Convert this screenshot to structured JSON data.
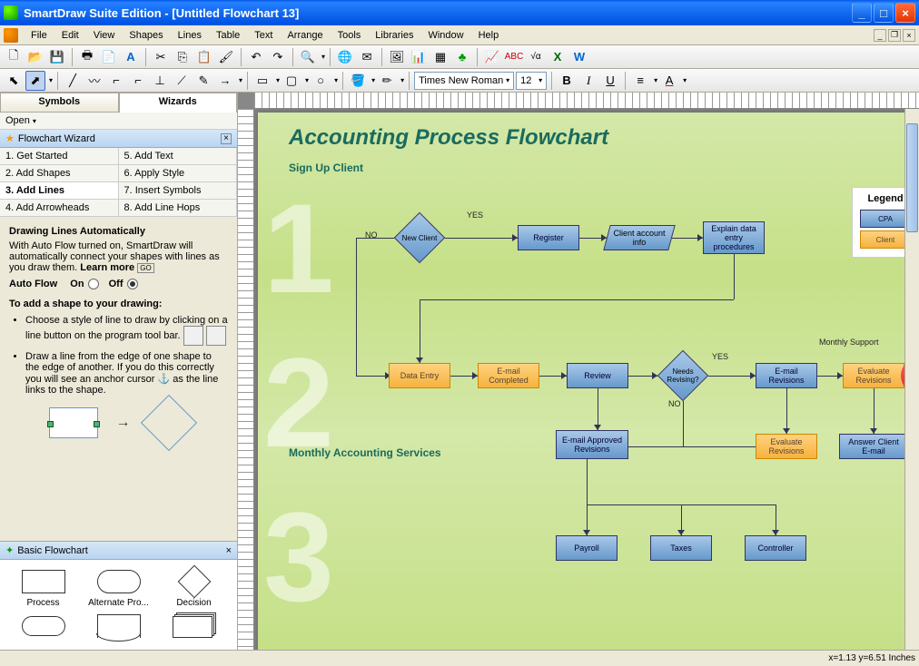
{
  "app": {
    "title": "SmartDraw Suite Edition - [Untitled Flowchart 13]"
  },
  "menu": [
    "File",
    "Edit",
    "View",
    "Shapes",
    "Lines",
    "Table",
    "Text",
    "Arrange",
    "Tools",
    "Libraries",
    "Window",
    "Help"
  ],
  "toolbar2": {
    "font": "Times New Roman",
    "size": "12",
    "bold": "B",
    "italic": "I",
    "underline": "U"
  },
  "sidebar": {
    "open_label": "Open",
    "tabs": {
      "symbols": "Symbols",
      "wizards": "Wizards"
    },
    "wizard_title": "Flowchart Wizard",
    "steps": [
      "1. Get Started",
      "5. Add Text",
      "2. Add Shapes",
      "6. Apply Style",
      "3. Add Lines",
      "7. Insert Symbols",
      "4. Add Arrowheads",
      "8. Add Line Hops"
    ],
    "active_step_index": 4,
    "help": {
      "heading": "Drawing Lines Automatically",
      "para1_a": "With Auto Flow turned on, SmartDraw will automatically connect your shapes with lines as you draw them. ",
      "learn_more": "Learn more",
      "autoflow_label": "Auto Flow",
      "on": "On",
      "off": "Off",
      "subhead": "To add a shape to your drawing:",
      "bullet1": "Choose a style of line to draw by clicking on a line button on the program tool bar.",
      "bullet2_a": "Draw a line from the edge of one shape to the edge of another. If you do this correctly you will see an anchor cursor ",
      "bullet2_b": " as the line links to the shape."
    },
    "palette_title": "Basic Flowchart",
    "palette": [
      "Process",
      "Alternate Pro...",
      "Decision",
      "",
      "",
      ""
    ]
  },
  "doc": {
    "title": "Accounting Process Flowchart",
    "section1": "Sign Up Client",
    "section2": "Monthly Accounting Services",
    "legend_title": "Legend",
    "legend_items": [
      "CPA",
      "Client"
    ],
    "shapes": {
      "new_client": "New Client",
      "register": "Register",
      "client_info": "Client account info",
      "explain": "Explain data entry procedures",
      "data_entry": "Data Entry",
      "email_completed": "E-mail Completed",
      "review": "Review",
      "needs_revising": "Needs Revising?",
      "email_revisions": "E-mail Revisions",
      "evaluate_revisions": "Evaluate Revisions",
      "email_approved": "E-mail Approved Revisions",
      "evaluate_revisions2": "Evaluate Revisions",
      "answer_email": "Answer Client E-mail",
      "payroll": "Payroll",
      "taxes": "Taxes",
      "controller": "Controller",
      "monthly_support": "Monthly Support"
    },
    "labels": {
      "yes": "YES",
      "no": "NO",
      "yes2": "YES",
      "no2": "NO"
    }
  },
  "status": {
    "coords": "x=1.13  y=6.51 Inches"
  }
}
